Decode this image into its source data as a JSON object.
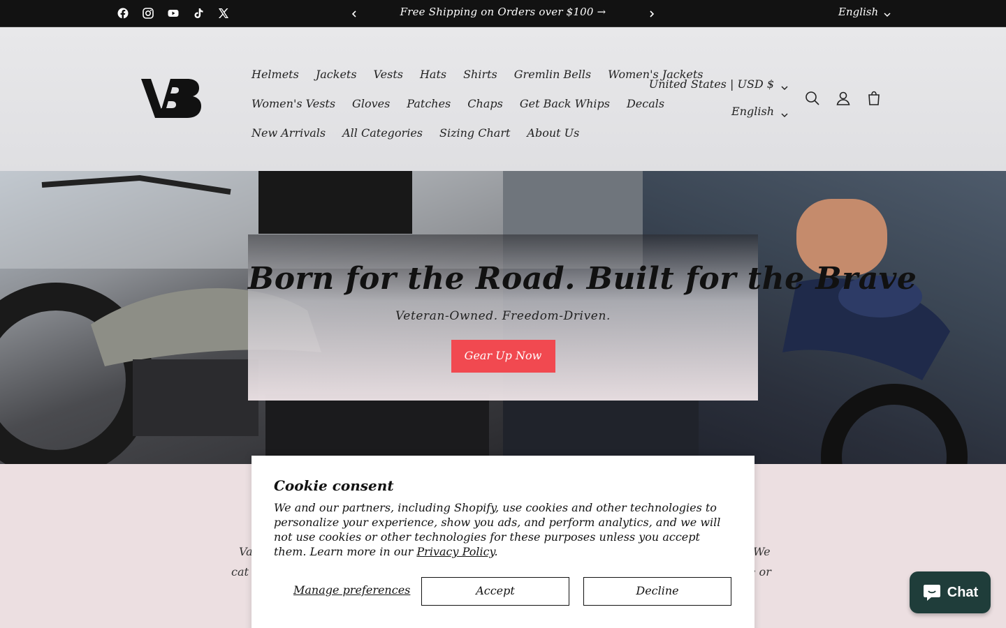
{
  "announcement": {
    "social_icons": [
      "facebook-icon",
      "instagram-icon",
      "youtube-icon",
      "tiktok-icon",
      "x-icon"
    ],
    "message": "Free Shipping on Orders over $100 →",
    "language": "English"
  },
  "header": {
    "logo_text": "VB",
    "nav_rows": [
      [
        "Helmets",
        "Jackets",
        "Vests",
        "Hats",
        "Shirts",
        "Gremlin Bells",
        "Women's Jackets"
      ],
      [
        "Women's Vests",
        "Gloves",
        "Patches",
        "Chaps",
        "Get Back Whips",
        "Decals"
      ],
      [
        "New Arrivals",
        "All Categories",
        "Sizing Chart",
        "About Us"
      ]
    ],
    "country_currency": "United States | USD $",
    "language": "English",
    "icons": [
      "search-icon",
      "account-icon",
      "cart-icon"
    ]
  },
  "hero": {
    "title": "Born for the Road. Built for the Brave",
    "subtitle": "Veteran-Owned. Freedom-Driven.",
    "button": "Gear Up Now"
  },
  "about_fragments": {
    "left_line1": "Va",
    "left_line2": "cat",
    "right_line1": "We",
    "right_line2": "e or"
  },
  "cookie": {
    "title": "Cookie consent",
    "body": "We and our partners, including Shopify, use cookies and other technologies to personalize your experience, show you ads, and perform analytics, and we will not use cookies or other technologies for these purposes unless you accept them. Learn more in our ",
    "link": "Privacy Policy",
    "after_link": ".",
    "manage": "Manage preferences",
    "accept": "Accept",
    "decline": "Decline"
  },
  "chat": {
    "label": "Chat"
  },
  "colors": {
    "accent": "#f14950",
    "bar": "#121212",
    "chat": "#1f3d3a"
  }
}
